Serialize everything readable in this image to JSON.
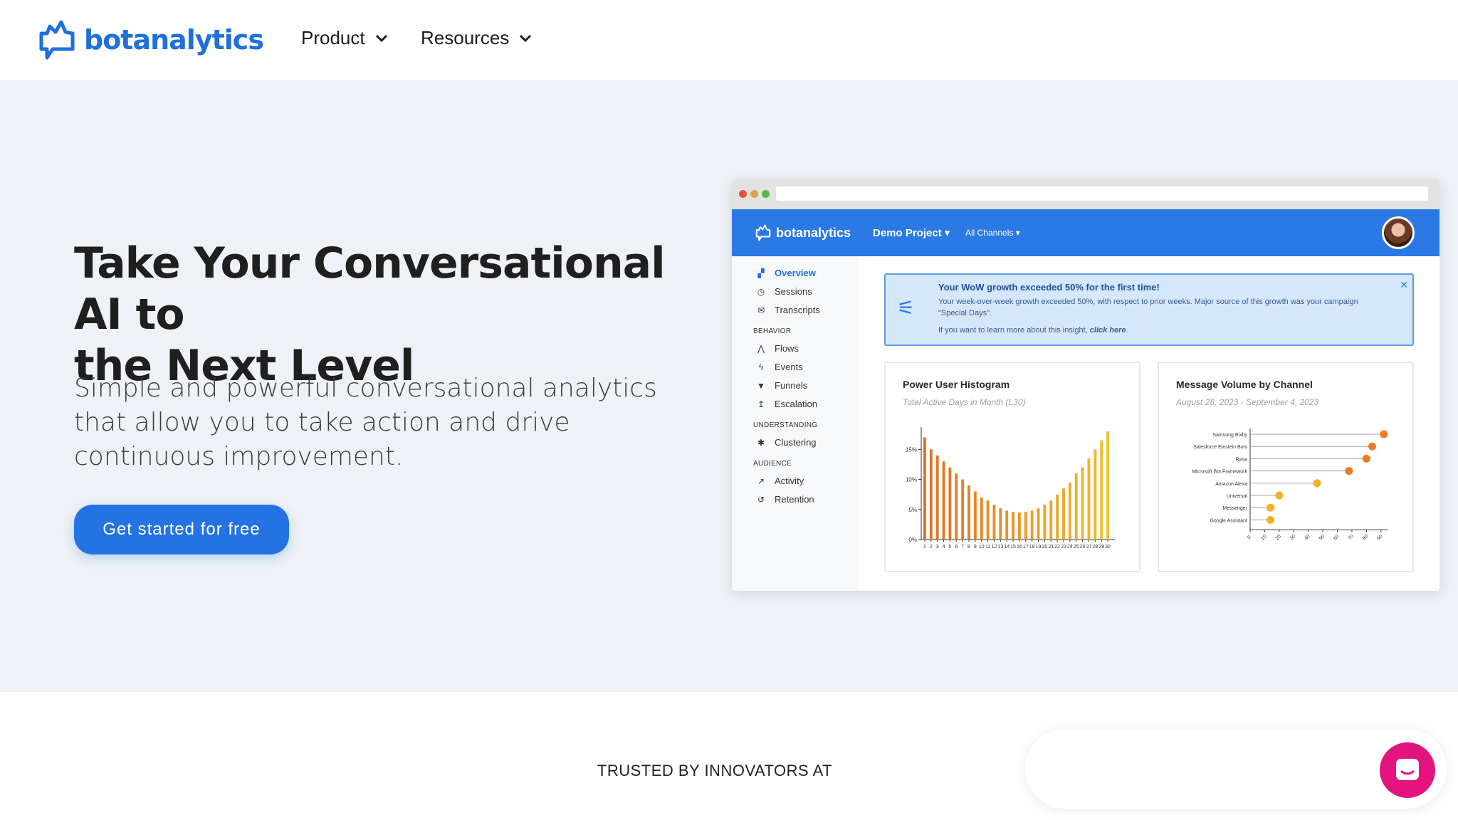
{
  "brand": {
    "name": "botanalytics",
    "color": "#1f6fdc"
  },
  "nav": {
    "items": [
      {
        "label": "Product"
      },
      {
        "label": "Resources"
      }
    ]
  },
  "hero": {
    "title_line1": "Take Your Conversational AI to",
    "title_line2": "the Next Level",
    "subtitle": "Simple and powerful conversational analytics that allow you to take action and drive continuous improvement.",
    "cta_label": "Get started for free",
    "accent": "#2473e2"
  },
  "mockup": {
    "brand": "botanalytics",
    "project": "Demo Project ▾",
    "channels": "All Channels ▾",
    "sidebar": {
      "items": [
        {
          "label": "Overview",
          "icon": "map-icon",
          "glyph": "▞",
          "active": true
        },
        {
          "label": "Sessions",
          "icon": "clock-icon",
          "glyph": "◷"
        },
        {
          "label": "Transcripts",
          "icon": "chat-icon",
          "glyph": "✉"
        }
      ],
      "behavior_head": "BEHAVIOR",
      "behavior": [
        {
          "label": "Flows",
          "icon": "road-icon",
          "glyph": "⋀"
        },
        {
          "label": "Events",
          "icon": "bolt-icon",
          "glyph": "ϟ"
        },
        {
          "label": "Funnels",
          "icon": "filter-icon",
          "glyph": "▼"
        },
        {
          "label": "Escalation",
          "icon": "escalation-icon",
          "glyph": "↥"
        }
      ],
      "understanding_head": "UNDERSTANDING",
      "understanding": [
        {
          "label": "Clustering",
          "icon": "asterisk-icon",
          "glyph": "✱"
        }
      ],
      "audience_head": "AUDIENCE",
      "audience": [
        {
          "label": "Activity",
          "icon": "line-chart-icon",
          "glyph": "↗"
        },
        {
          "label": "Retention",
          "icon": "history-icon",
          "glyph": "↺"
        }
      ]
    },
    "alert": {
      "title": "Your WoW growth exceeded 50% for the first time!",
      "body": "Your week-over-week growth exceeded 50%, with respect to prior weeks. Major source of this growth was your campaign \"Special Days\".",
      "link_prefix": "If you want to learn more about this insight,",
      "link_text": "click here",
      "link_suffix": "."
    },
    "histogram": {
      "title": "Power User Histogram",
      "subtitle": "Total Active Days in Month (L30)"
    },
    "volume": {
      "title": "Message Volume by Channel",
      "subtitle": "August 28, 2023 - September 4, 2023"
    }
  },
  "chart_data": [
    {
      "type": "bar",
      "title": "Power User Histogram",
      "subtitle": "Total Active Days in Month (L30)",
      "categories": [
        "1",
        "2",
        "3",
        "4",
        "5",
        "6",
        "7",
        "8",
        "9",
        "10",
        "11",
        "12",
        "13",
        "14",
        "15",
        "16",
        "17",
        "18",
        "19",
        "20",
        "21",
        "22",
        "23",
        "24",
        "25",
        "26",
        "27",
        "28",
        "29",
        "30"
      ],
      "values": [
        17,
        15,
        14,
        13,
        12,
        11,
        10,
        9,
        8,
        7,
        6.5,
        5.8,
        5.2,
        4.8,
        4.6,
        4.5,
        4.6,
        4.8,
        5.2,
        5.8,
        6.5,
        7.5,
        8.5,
        9.5,
        11,
        12,
        13.5,
        15,
        16.5,
        18
      ],
      "yticks": [
        "0%",
        "5%",
        "10%",
        "15%"
      ],
      "ylim": [
        0,
        18
      ],
      "xlabel": "",
      "ylabel": ""
    },
    {
      "type": "scatter",
      "title": "Message Volume by Channel",
      "subtitle": "August 28, 2023 - September 4, 2023",
      "categories": [
        "Samsung Bixby",
        "Salesforce Einstein Bots",
        "Rasa",
        "Microsoft Bot Framework",
        "Amazon Alexa",
        "Universal",
        "Messenger",
        "Google Assistant"
      ],
      "values": [
        92,
        84,
        80,
        68,
        46,
        20,
        14,
        14
      ],
      "xticks": [
        "0",
        "10",
        "20",
        "30",
        "40",
        "50",
        "60",
        "70",
        "80",
        "90"
      ],
      "xlim": [
        0,
        95
      ],
      "xlabel": "",
      "ylabel": ""
    }
  ],
  "trusted": "TRUSTED BY INNOVATORS AT",
  "chat": {
    "accent": "#e3147d"
  }
}
